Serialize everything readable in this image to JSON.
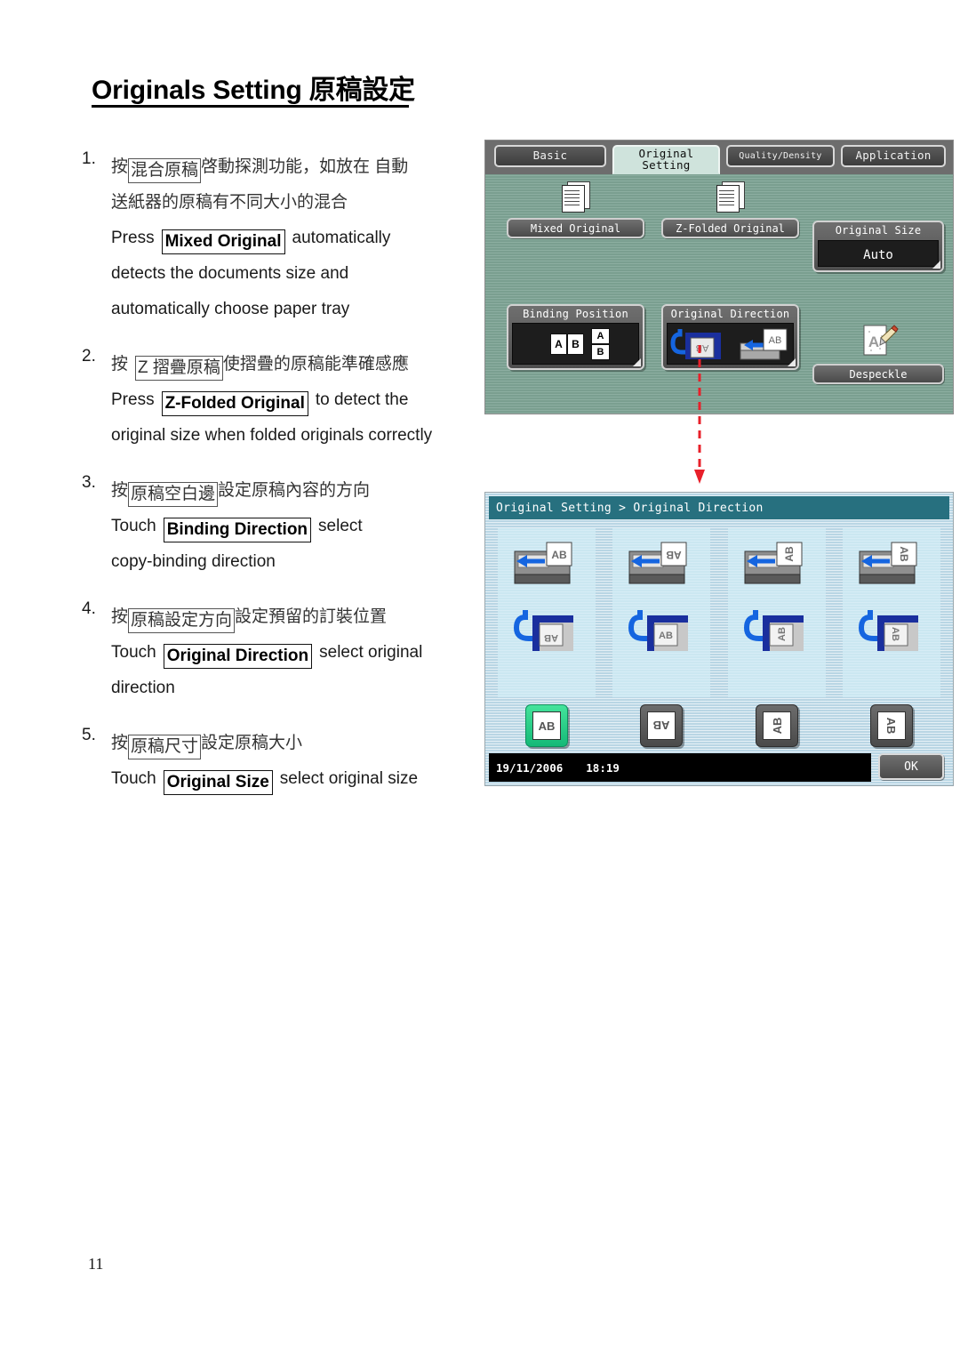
{
  "document": {
    "title": "Originals Setting 原稿設定",
    "page_number": "11"
  },
  "steps": [
    {
      "num": "1.",
      "cn_pre": "按",
      "cn_box": "混合原稿",
      "cn_post": "啓動探測功能，如放在 自動",
      "cn_line2": "送紙器的原稿有不同大小的混合",
      "en_pre": "Press",
      "en_box": "Mixed Original",
      "en_post": "automatically",
      "en_line2": "detects the documents size and",
      "en_line3": "automatically choose paper tray"
    },
    {
      "num": "2.",
      "cn_pre": "按",
      "cn_box": "Z 摺疊原稿",
      "cn_post": "使摺疊的原稿能準確感應",
      "en_pre": "Press",
      "en_box": "Z-Folded Original",
      "en_post": "to detect the",
      "en_line2": "original size when folded originals correctly"
    },
    {
      "num": "3.",
      "cn_pre": "按",
      "cn_box": "原稿空白邊",
      "cn_post": "設定原稿內容的方向",
      "en_pre": "Touch",
      "en_box": "Binding Direction",
      "en_post": "select",
      "en_line2": "copy-binding direction"
    },
    {
      "num": "4.",
      "cn_pre": "按",
      "cn_box": "原稿設定方向",
      "cn_post": "設定預留的訂裝位置",
      "en_pre": "Touch",
      "en_box": "Original Direction",
      "en_post": "select original",
      "en_line2": "direction"
    },
    {
      "num": "5.",
      "cn_pre": "按",
      "cn_box": "原稿尺寸",
      "cn_post": "設定原稿大小",
      "en_pre": "Touch",
      "en_box": "Original Size",
      "en_post": "select original size"
    }
  ],
  "lcd_original_setting": {
    "tabs": [
      {
        "label": "Basic",
        "active": false
      },
      {
        "label": "Original Setting",
        "active": true
      },
      {
        "label": "Quality/\nDensity",
        "active": false
      },
      {
        "label": "Application",
        "active": false
      }
    ],
    "tab_quality_line1": "Quality/",
    "tab_quality_line2": "Density",
    "buttons": {
      "mixed_original": "Mixed Original",
      "z_folded_original": "Z-Folded Original",
      "despeckle": "Despeckle"
    },
    "original_size": {
      "title": "Original Size",
      "value": "Auto"
    },
    "binding_position": {
      "title": "Binding Position",
      "page_a": "A",
      "page_b": "B"
    },
    "original_direction": {
      "title": "Original Direction",
      "chip_label": "AB"
    }
  },
  "lcd_original_direction": {
    "breadcrumb": "Original Setting > Original Direction",
    "options": [
      {
        "chip": "AB",
        "selected": true,
        "rotation": 0
      },
      {
        "chip": "AB",
        "selected": false,
        "rotation": 180
      },
      {
        "chip": "AB",
        "selected": false,
        "rotation": 90
      },
      {
        "chip": "AB",
        "selected": false,
        "rotation": 270
      }
    ],
    "status": {
      "date": "19/11/2006",
      "time": "18:19"
    },
    "ok_label": "OK"
  },
  "colors": {
    "panel_green": "#7fa596",
    "panel_blue": "#cfe4ef",
    "breadcrumb_teal": "#27707f",
    "selected_green": "#14b977",
    "connector_red": "#e8202a"
  }
}
